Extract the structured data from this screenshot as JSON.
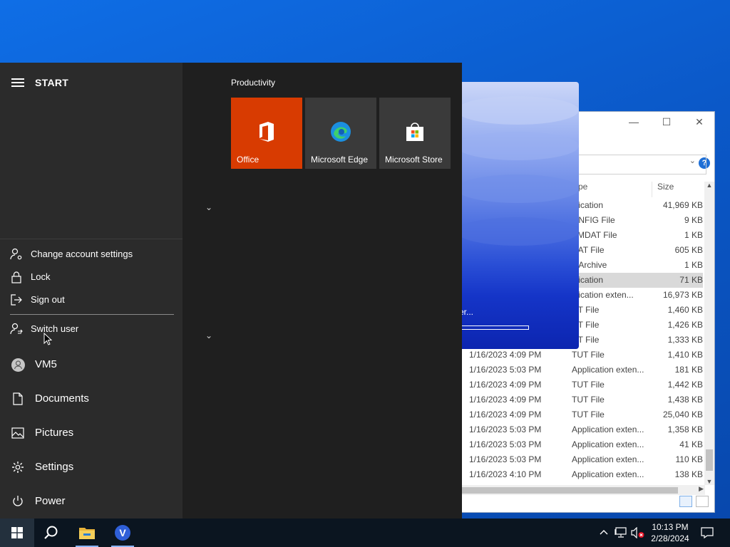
{
  "start_menu": {
    "title": "START",
    "account_flyout": {
      "items": [
        {
          "label": "Change account settings",
          "icon": "person-gear-icon"
        },
        {
          "label": "Lock",
          "icon": "lock-icon"
        },
        {
          "label": "Sign out",
          "icon": "sign-out-icon"
        },
        {
          "label": "Switch user",
          "icon": "switch-user-icon"
        }
      ]
    },
    "nav": {
      "user": "VM5",
      "documents": "Documents",
      "pictures": "Pictures",
      "settings": "Settings",
      "power": "Power"
    },
    "group_title": "Productivity",
    "tiles": [
      {
        "label": "Office",
        "color": "#d83b01"
      },
      {
        "label": "Microsoft Edge",
        "color": "#3a3a3a"
      },
      {
        "label": "Microsoft Store",
        "color": "#3a3a3a"
      }
    ]
  },
  "installer": {
    "line1": ")",
    "line2": "er..."
  },
  "explorer": {
    "columns": {
      "type": "pe",
      "size": "Size"
    },
    "rows": [
      {
        "date": "",
        "type": "plication",
        "size": "41,969 KB"
      },
      {
        "date": "",
        "type": "ONFIG File",
        "size": "9 KB"
      },
      {
        "date": "",
        "type": "EMDAT File",
        "size": "1 KB"
      },
      {
        "date": "",
        "type": "DAT File",
        "size": "605 KB"
      },
      {
        "date": "",
        "type": "p Archive",
        "size": "1 KB"
      },
      {
        "date": "",
        "type": "plication",
        "size": "71 KB",
        "selected": true
      },
      {
        "date": "",
        "type": "plication exten...",
        "size": "16,973 KB"
      },
      {
        "date": "",
        "type": "UT File",
        "size": "1,460 KB"
      },
      {
        "date": "",
        "type": "UT File",
        "size": "1,426 KB"
      },
      {
        "date": "",
        "type": "UT File",
        "size": "1,333 KB"
      },
      {
        "date": "1/16/2023 4:09 PM",
        "type": "TUT File",
        "size": "1,410 KB"
      },
      {
        "date": "1/16/2023 5:03 PM",
        "type": "Application exten...",
        "size": "181 KB"
      },
      {
        "date": "1/16/2023 4:09 PM",
        "type": "TUT File",
        "size": "1,442 KB"
      },
      {
        "date": "1/16/2023 4:09 PM",
        "type": "TUT File",
        "size": "1,438 KB"
      },
      {
        "date": "1/16/2023 4:09 PM",
        "type": "TUT File",
        "size": "25,040 KB"
      },
      {
        "date": "1/16/2023 5:03 PM",
        "type": "Application exten...",
        "size": "1,358 KB"
      },
      {
        "date": "1/16/2023 5:03 PM",
        "type": "Application exten...",
        "size": "41 KB"
      },
      {
        "date": "1/16/2023 5:03 PM",
        "type": "Application exten...",
        "size": "110 KB"
      },
      {
        "date": "1/16/2023 4:10 PM",
        "type": "Application exten...",
        "size": "138 KB"
      }
    ]
  },
  "taskbar": {
    "time": "10:13 PM",
    "date": "2/28/2024",
    "pinned": [
      "windows-start",
      "search",
      "file-explorer",
      "v-app"
    ]
  },
  "colors": {
    "accent": "#8ab4f8",
    "office_tile": "#d83b01",
    "start_bg": "#1f1f1f",
    "start_left_bg": "#2b2b2b"
  }
}
